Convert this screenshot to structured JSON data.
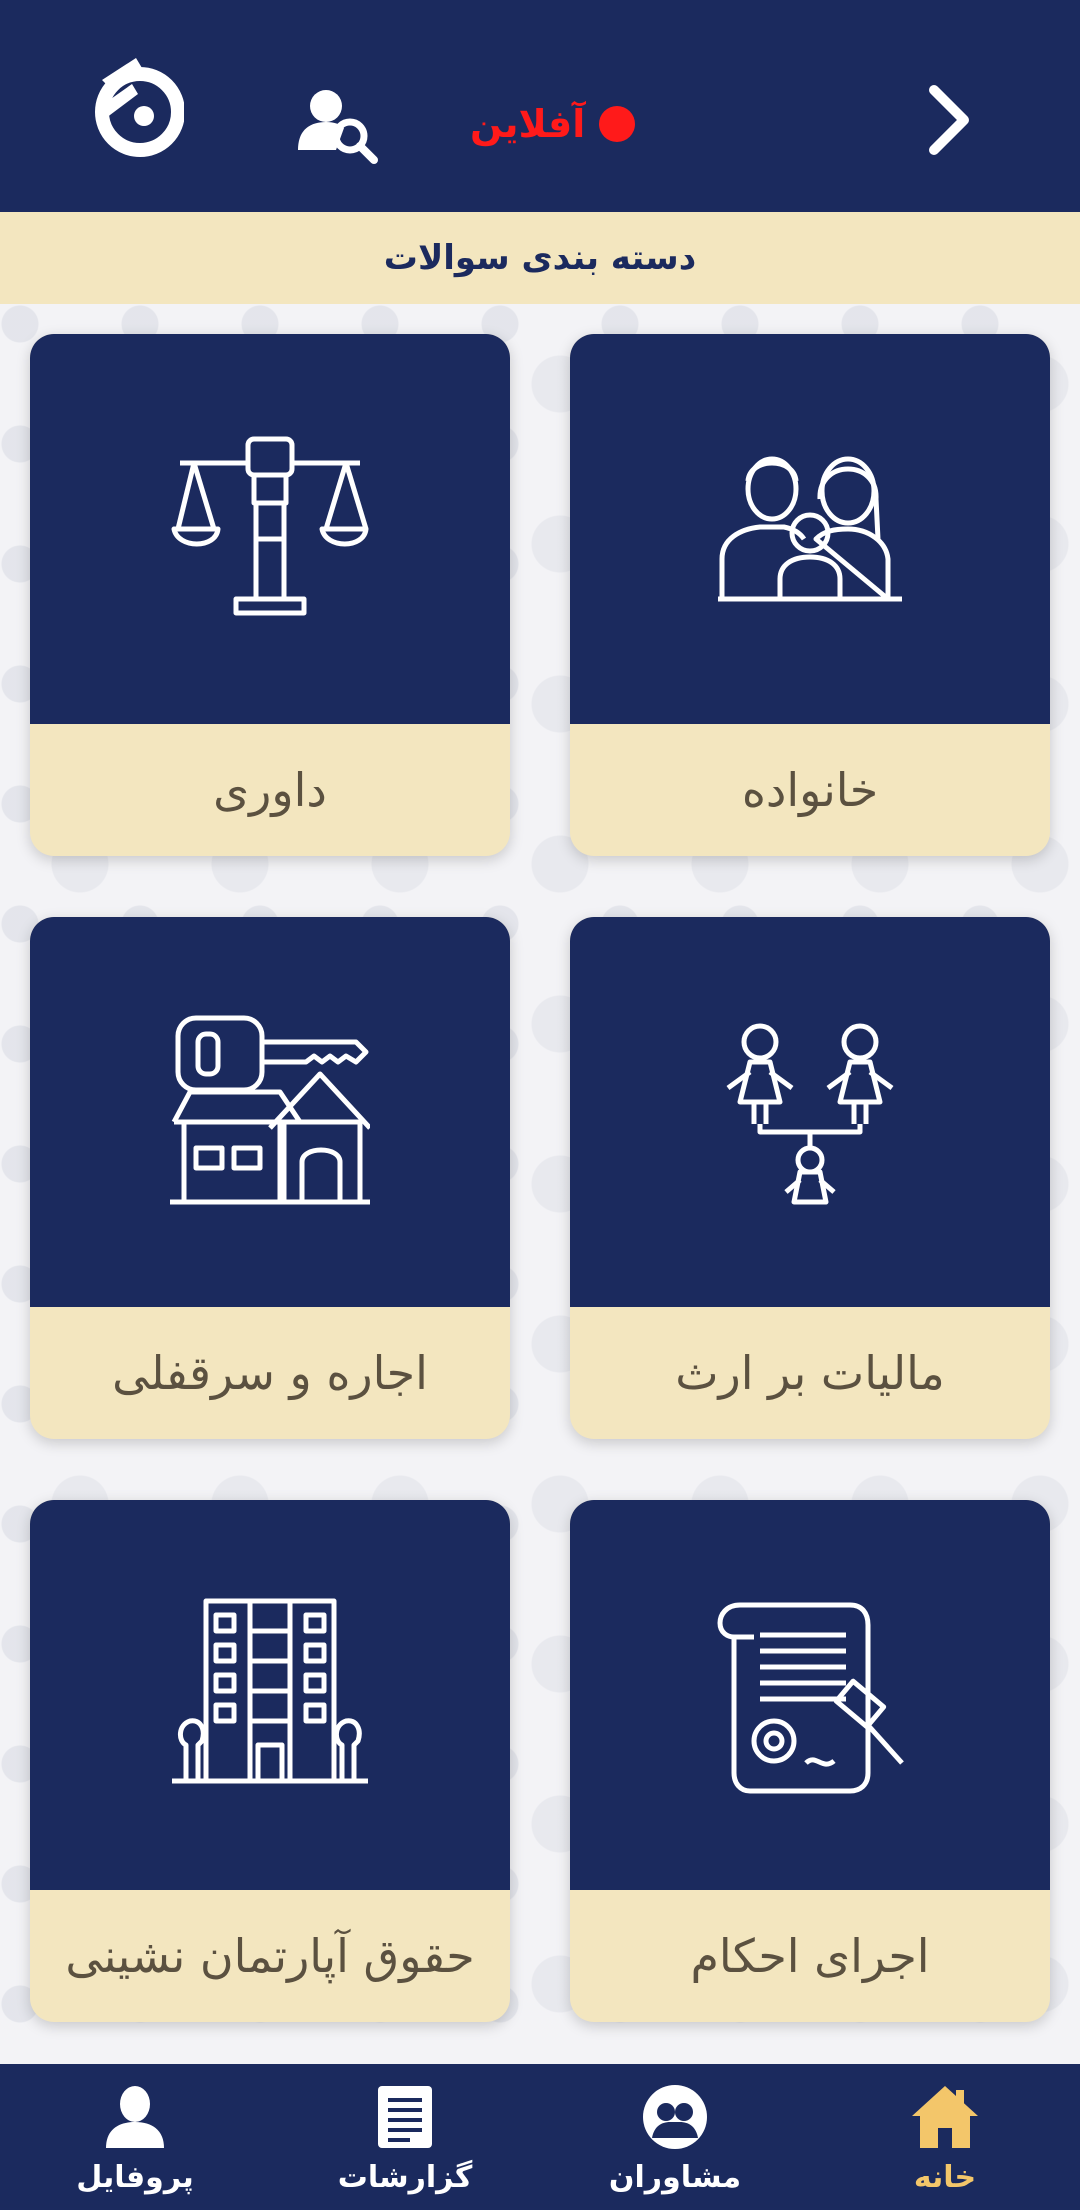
{
  "header": {
    "status_text": "آفلاین",
    "status_color": "#ff1a1a",
    "logo_icon": "brand-logo-icon",
    "search_icon": "user-search-icon",
    "forward_icon": "chevron-right-icon"
  },
  "section": {
    "title": "دسته بندی سوالات"
  },
  "categories": [
    {
      "label": "خانواده",
      "icon": "family-icon"
    },
    {
      "label": "داوری",
      "icon": "justice-scale-icon"
    },
    {
      "label": "مالیات بر ارث",
      "icon": "inheritance-icon"
    },
    {
      "label": "اجاره و سرقفلی",
      "icon": "house-key-icon"
    },
    {
      "label": "اجرای احکام",
      "icon": "verdict-document-icon"
    },
    {
      "label": "حقوق آپارتمان نشینی",
      "icon": "apartment-building-icon"
    }
  ],
  "nav": {
    "items": [
      {
        "label": "خانه",
        "icon": "home-icon",
        "active": true
      },
      {
        "label": "مشاوران",
        "icon": "advisors-icon",
        "active": false
      },
      {
        "label": "گزارشات",
        "icon": "reports-icon",
        "active": false
      },
      {
        "label": "پروفایل",
        "icon": "profile-icon",
        "active": false
      }
    ]
  },
  "colors": {
    "primary": "#1b2a5e",
    "cream": "#f3e6bf",
    "active_nav": "#f3c66a"
  }
}
